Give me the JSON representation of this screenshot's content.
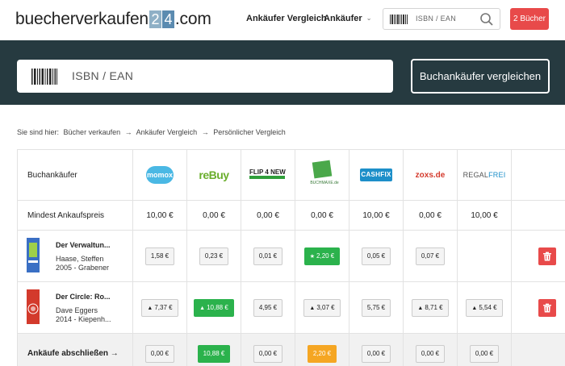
{
  "header": {
    "logo": {
      "part1": "buecherverkaufen",
      "digit1": "2",
      "digit2": "4",
      "domain": ".com"
    },
    "nav": {
      "compare": "Ankäufer Vergleich",
      "buyers": "Ankäufer"
    },
    "search_placeholder": "ISBN / EAN",
    "cart_label": "2 Bücher"
  },
  "hero": {
    "search_placeholder": "ISBN / EAN",
    "compare_button": "Buchankäufer vergleichen"
  },
  "breadcrumb": [
    "Sie sind hier:",
    "Bücher verkaufen",
    "→",
    "Ankäufer Vergleich",
    "→",
    "Persönlicher Vergleich"
  ],
  "table": {
    "header_label": "Buchankäufer",
    "vendors": [
      {
        "name": "momox",
        "logo_text": "momox"
      },
      {
        "name": "reBuy",
        "logo_text": "reBuy"
      },
      {
        "name": "FLIP4NEW",
        "logo_text": "FLIP 4 NEW"
      },
      {
        "name": "Buchmaxe",
        "logo_text": "BUCHMAXE.de"
      },
      {
        "name": "CASHFIX",
        "logo_text": "CASHFIX"
      },
      {
        "name": "zoxs.de",
        "logo_text": "zoxs.de"
      },
      {
        "name": "Regalfrei",
        "logo_text_1": "REGAL",
        "logo_text_2": "FREI"
      }
    ],
    "min_label": "Mindest Ankaufspreis",
    "min_prices": [
      "10,00 €",
      "0,00 €",
      "0,00 €",
      "0,00 €",
      "10,00 €",
      "0,00 €",
      "10,00 €"
    ],
    "books": [
      {
        "title": "Der Verwaltun...",
        "author": "Haase, Steffen",
        "meta": "2005 - Grabener",
        "cover_color": "#3a6fc4",
        "prices": [
          {
            "value": "1,58 €",
            "style": "plain",
            "marker": ""
          },
          {
            "value": "0,23 €",
            "style": "plain",
            "marker": ""
          },
          {
            "value": "0,01 €",
            "style": "plain",
            "marker": ""
          },
          {
            "value": "2,20 €",
            "style": "green",
            "marker": "★"
          },
          {
            "value": "0,05 €",
            "style": "plain",
            "marker": ""
          },
          {
            "value": "0,07 €",
            "style": "plain",
            "marker": ""
          },
          null
        ]
      },
      {
        "title": "Der Circle: Ro...",
        "author": "Dave Eggers",
        "meta": "2014 - Kiepenh...",
        "cover_color": "#d33a2c",
        "prices": [
          {
            "value": "7,37 €",
            "style": "plain",
            "marker": "▲"
          },
          {
            "value": "10,88 €",
            "style": "green",
            "marker": "▲"
          },
          {
            "value": "4,95 €",
            "style": "plain",
            "marker": ""
          },
          {
            "value": "3,07 €",
            "style": "plain",
            "marker": "▲"
          },
          {
            "value": "5,75 €",
            "style": "plain",
            "marker": ""
          },
          {
            "value": "8,71 €",
            "style": "plain",
            "marker": "▲"
          },
          {
            "value": "5,54 €",
            "style": "plain",
            "marker": "▲"
          }
        ]
      }
    ],
    "final_label": "Ankäufe abschließen →",
    "final_prices": [
      {
        "value": "0,00 €",
        "style": "plain"
      },
      {
        "value": "10,88 €",
        "style": "green"
      },
      {
        "value": "0,00 €",
        "style": "plain"
      },
      {
        "value": "2,20 €",
        "style": "orange"
      },
      {
        "value": "0,00 €",
        "style": "plain"
      },
      {
        "value": "0,00 €",
        "style": "plain"
      },
      {
        "value": "0,00 €",
        "style": "plain"
      }
    ]
  },
  "colors": {
    "hero_bg": "#263a40",
    "accent_red": "#e84a4a",
    "best_green": "#2bb24c",
    "partial_orange": "#f5a623"
  },
  "icons": {
    "search": "magnifier-icon",
    "barcode": "barcode-icon",
    "delete": "trash-icon",
    "dropdown": "chevron-down-icon"
  }
}
